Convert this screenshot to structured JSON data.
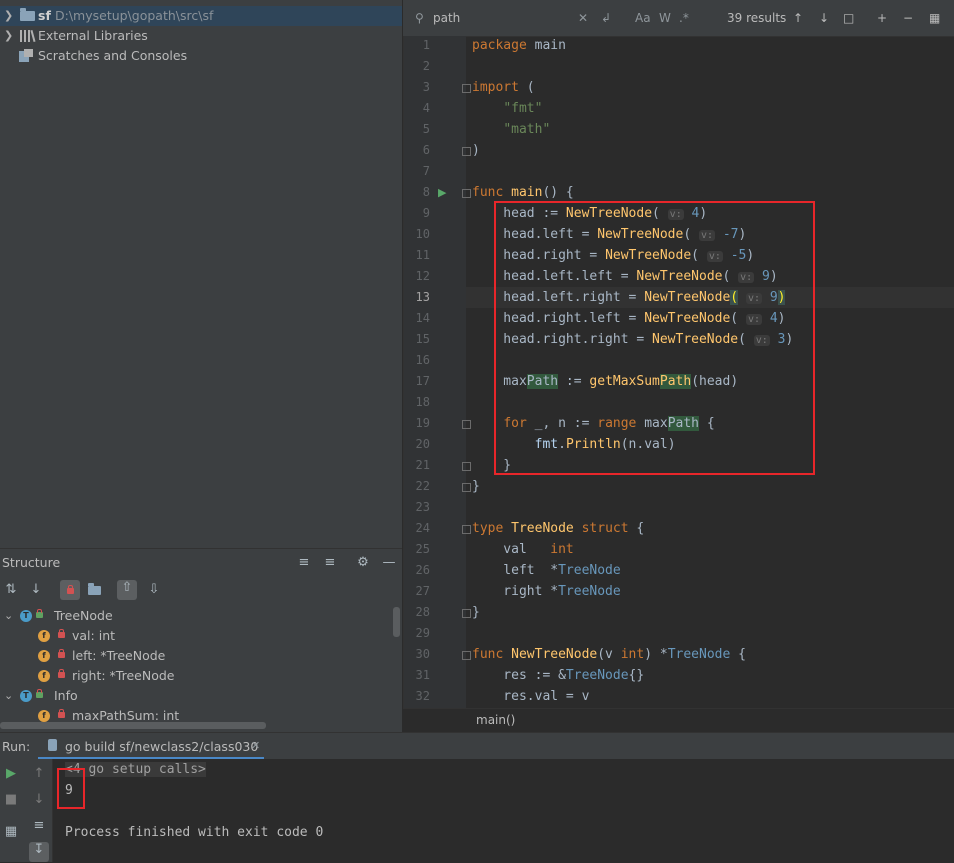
{
  "project": {
    "root": {
      "name": "sf",
      "path": "D:\\mysetup\\gopath\\src\\sf"
    },
    "external": "External Libraries",
    "scratches": "Scratches and Consoles"
  },
  "structure": {
    "title": "Structure",
    "items": [
      {
        "label": "TreeNode",
        "kind": "T"
      },
      {
        "label": "val: int",
        "kind": "f"
      },
      {
        "label": "left: *TreeNode",
        "kind": "f"
      },
      {
        "label": "right: *TreeNode",
        "kind": "f"
      },
      {
        "label": "Info",
        "kind": "T"
      },
      {
        "label": "maxPathSum: int",
        "kind": "f"
      }
    ]
  },
  "search": {
    "query": "path",
    "results": "39 results",
    "case_label": "Aa",
    "word_label": "W"
  },
  "editor": {
    "line_numbers": [
      "1",
      "2",
      "3",
      "4",
      "5",
      "6",
      "7",
      "8",
      "9",
      "10",
      "11",
      "12",
      "13",
      "14",
      "15",
      "16",
      "17",
      "18",
      "19",
      "20",
      "21",
      "22",
      "23",
      "24",
      "25",
      "26",
      "27",
      "28",
      "29",
      "30",
      "31",
      "32"
    ],
    "current_line": "13",
    "breadcrumb": "main()"
  },
  "run": {
    "label": "Run:",
    "tab": "go build sf/newclass2/class030",
    "console": {
      "setup": "<4 go setup calls>",
      "output": "9",
      "finish": "Process finished with exit code 0"
    }
  },
  "colors": {
    "highlight_box": "#e8262a",
    "keyword": "#cc7832",
    "function": "#ffc66d",
    "string": "#6a8759"
  }
}
